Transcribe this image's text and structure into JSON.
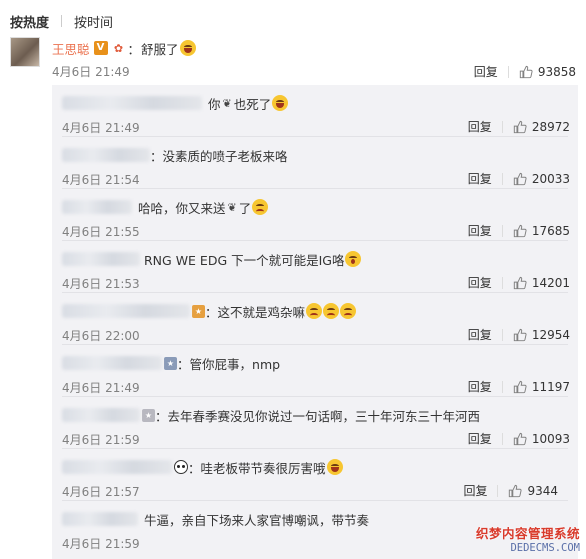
{
  "sort": {
    "hot": "按热度",
    "time": "按时间"
  },
  "main": {
    "name": "王思聪",
    "verified_badge": "V",
    "text": "舒服了",
    "time": "4月6日 21:49",
    "reply_label": "回复",
    "likes": "93858"
  },
  "replies": [
    {
      "text": "你",
      "text2": "也死了",
      "time": "4月6日 21:49",
      "reply_label": "回复",
      "likes": "28972"
    },
    {
      "text": "没素质的喷子老板来咯",
      "time": "4月6日 21:54",
      "reply_label": "回复",
      "likes": "20033"
    },
    {
      "text": "哈哈，你又来送",
      "text2": "了",
      "time": "4月6日 21:55",
      "reply_label": "回复",
      "likes": "17685"
    },
    {
      "text": "RNG WE EDG 下一个就可能是IG咯",
      "time": "4月6日 21:53",
      "reply_label": "回复",
      "likes": "14201"
    },
    {
      "text": "这不就是鸡杂嘛",
      "time": "4月6日 22:00",
      "reply_label": "回复",
      "likes": "12954"
    },
    {
      "text": "管你屁事，nmp",
      "time": "4月6日 21:49",
      "reply_label": "回复",
      "likes": "11197"
    },
    {
      "text": "去年春季赛没见你说过一句话啊，三十年河东三十年河西",
      "time": "4月6日 21:59",
      "reply_label": "回复",
      "likes": "10093"
    },
    {
      "text": "哇老板带节奏很厉害哦",
      "time": "4月6日 21:57",
      "reply_label": "回复",
      "likes": "9344"
    },
    {
      "text": "牛逼，亲自下场来人家官博嘲讽，带节奏",
      "time": "4月6日 21:59",
      "reply_label": "回复",
      "likes": ""
    }
  ],
  "watermark": {
    "cn": "织梦内容管理系统",
    "en": "DEDECMS.COM"
  },
  "colors": {
    "name": "#eb7350",
    "reply_bg": "#f2f2f5",
    "meta": "#808080"
  }
}
